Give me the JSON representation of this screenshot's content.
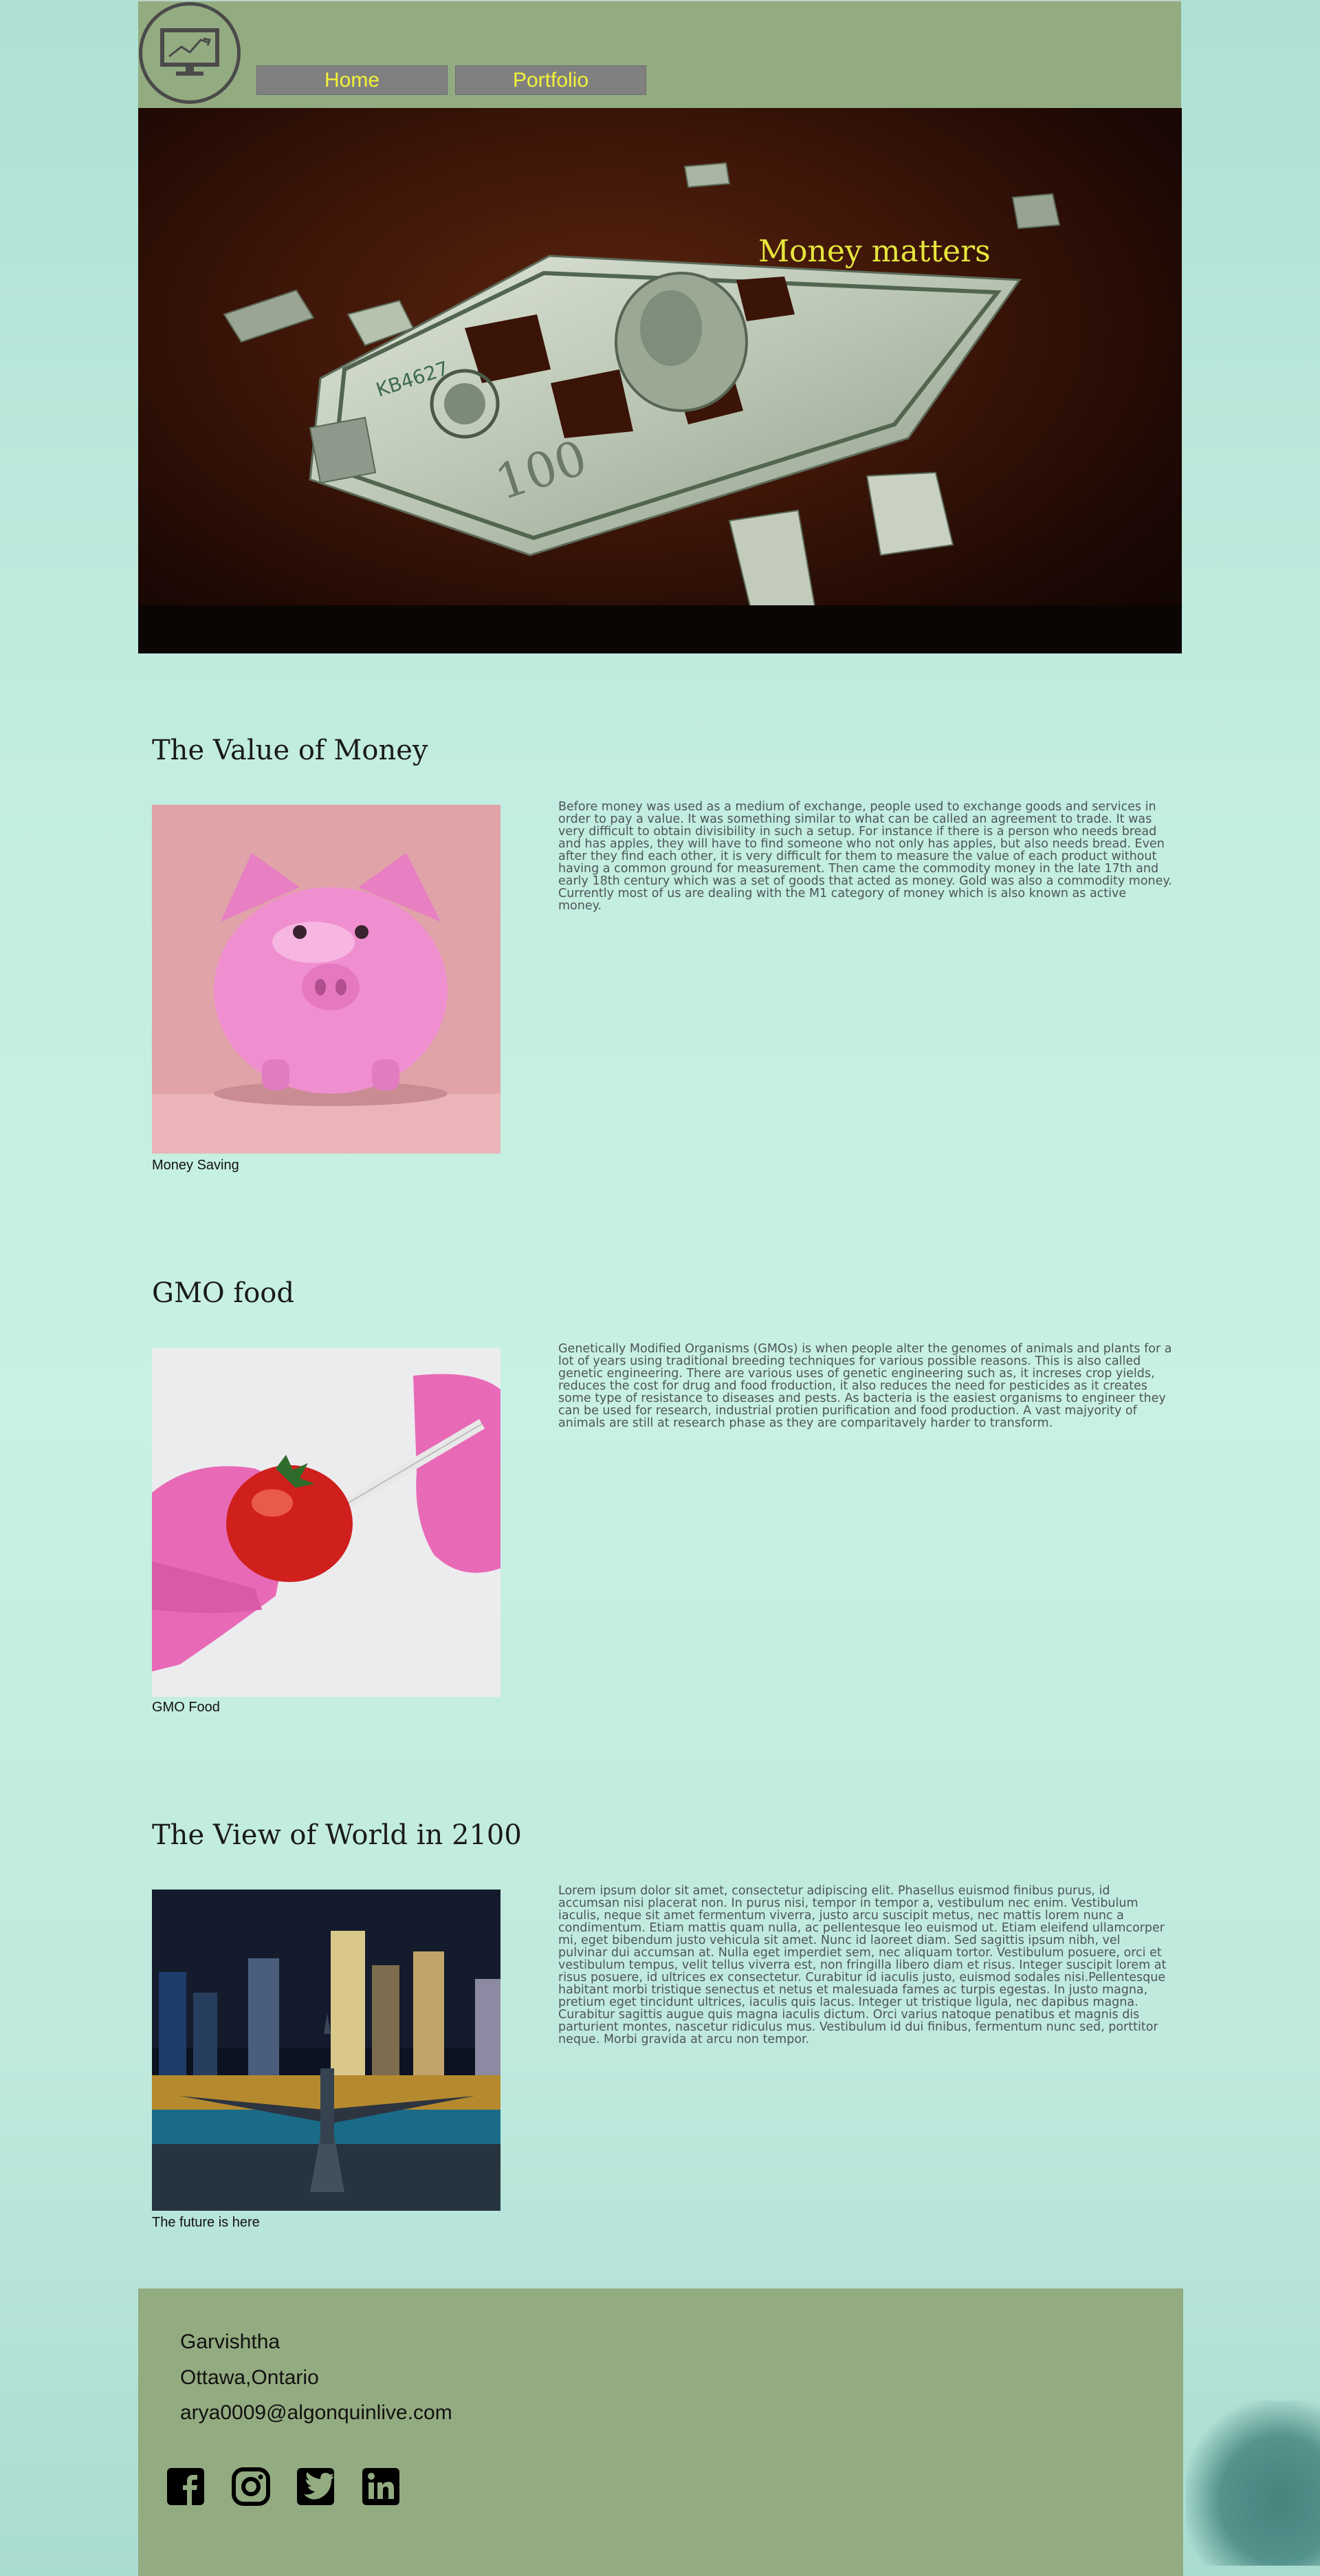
{
  "nav": {
    "home_label": "Home",
    "portfolio_label": "Portfolio"
  },
  "hero": {
    "title": "Money matters"
  },
  "sections": [
    {
      "title": "The Value of Money",
      "caption": "Money Saving",
      "text": "Before money was used as a medium of exchange, people used to exchange goods and services in order to pay a value. It was something similar to what can be called an agreement to trade. It was very difficult to obtain divisibility in such a setup. For instance if there is a person who needs bread and has apples, they will have to find someone who not only has apples, but also needs bread. Even after they find each other, it is very difficult for them to measure the value of each product without having a common ground for measurement. Then came the commodity money in the late 17th and early 18th century which was a set of goods that acted as money. Gold was also a commodity money. Currently most of us are dealing with the M1 category of money which is also known as active money."
    },
    {
      "title": "GMO food",
      "caption": "GMO Food",
      "text": "Genetically Modified Organisms (GMOs) is when people alter the genomes of animals and plants for a lot of years using traditional breeding techniques for various possible reasons. This is also called genetic engineering. There are various uses of genetic engineering such as, it increses crop yields, reduces the cost for drug and food froduction, it also reduces the need for pesticides as it creates some type of resistance to diseases and pests. As bacteria is the easiest organisms to engineer they can be used for research, industrial protien purification and food production. A vast majyority of animals are still at research phase as they are comparitavely harder to transform."
    },
    {
      "title": "The View of World in 2100",
      "caption": "The future is here",
      "text": "Lorem ipsum dolor sit amet, consectetur adipiscing elit. Phasellus euismod finibus purus, id accumsan nisi placerat non. In purus nisi, tempor in tempor a, vestibulum nec enim. Vestibulum iaculis, neque sit amet fermentum viverra, justo arcu suscipit metus, nec mattis lorem nunc a condimentum. Etiam mattis quam nulla, ac pellentesque leo euismod ut. Etiam eleifend ullamcorper mi, eget bibendum justo vehicula sit amet. Nunc id laoreet diam. Sed sagittis ipsum nibh, vel pulvinar dui accumsan at. Nulla eget imperdiet sem, nec aliquam tortor. Vestibulum posuere, orci et vestibulum tempus, velit tellus viverra est, non fringilla libero diam et risus. Integer suscipit lorem at risus posuere, id ultrices ex consectetur. Curabitur id iaculis justo, euismod sodales nisi.Pellentesque habitant morbi tristique senectus et netus et malesuada fames ac turpis egestas. In justo magna, pretium eget tincidunt ultrices, iaculis quis lacus. Integer ut tristique ligula, nec dapibus magna. Curabitur sagittis augue quis magna iaculis dictum. Orci varius natoque penatibus et magnis dis parturient montes, nascetur ridiculus mus. Vestibulum id dui finibus, fermentum nunc sed, porttitor neque. Morbi gravida at arcu non tempor."
    }
  ],
  "footer": {
    "name": "Garvishtha",
    "location": "Ottawa,Ontario",
    "email": "arya0009@algonquinlive.com"
  },
  "icons": {
    "logo": "monitor-chart-icon",
    "social": [
      "facebook-icon",
      "instagram-icon",
      "twitter-icon",
      "linkedin-icon"
    ]
  },
  "colors": {
    "header_footer_bg": "#93ab80",
    "nav_button_bg": "#808080",
    "accent_yellow": "#f2f23a",
    "page_bg": "#c2ede0"
  }
}
